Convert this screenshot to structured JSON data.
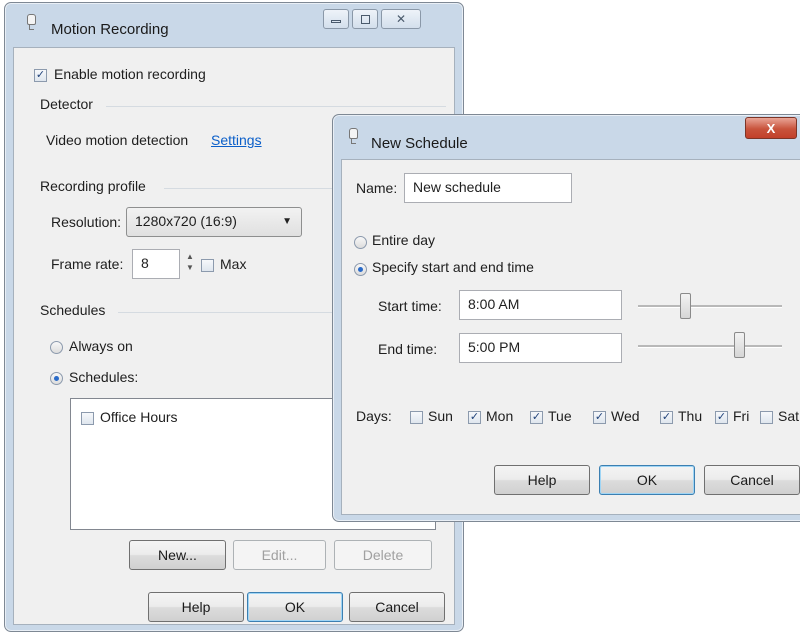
{
  "main_window": {
    "title": "Motion Recording",
    "enable_motion_recording": {
      "label": "Enable motion recording",
      "checked": true
    },
    "detector": {
      "heading": "Detector",
      "text": "Video motion detection",
      "settings_link": "Settings"
    },
    "recording_profile": {
      "heading": "Recording profile",
      "resolution_label": "Resolution:",
      "resolution_value": "1280x720 (16:9)",
      "frame_rate_label": "Frame rate:",
      "frame_rate_value": "8",
      "max_label": "Max",
      "max_checked": false
    },
    "schedules": {
      "heading": "Schedules",
      "always_on_label": "Always on",
      "schedules_label": "Schedules:",
      "selected": "schedules",
      "items": [
        {
          "label": "Office Hours",
          "checked": false
        }
      ],
      "new_button": "New...",
      "edit_button": "Edit...",
      "delete_button": "Delete"
    },
    "buttons": {
      "help": "Help",
      "ok": "OK",
      "cancel": "Cancel"
    }
  },
  "dialog": {
    "title": "New Schedule",
    "close_glyph": "X",
    "name_label": "Name:",
    "name_value": "New schedule",
    "entire_day_label": "Entire day",
    "specify_label": "Specify start and end time",
    "selected": "specify",
    "start_time_label": "Start time:",
    "start_time_value": "8:00 AM",
    "start_slider_fraction": 0.333,
    "end_time_label": "End time:",
    "end_time_value": "5:00 PM",
    "end_slider_fraction": 0.708,
    "days_label": "Days:",
    "days": [
      {
        "label": "Sun",
        "checked": false
      },
      {
        "label": "Mon",
        "checked": true
      },
      {
        "label": "Tue",
        "checked": true
      },
      {
        "label": "Wed",
        "checked": true
      },
      {
        "label": "Thu",
        "checked": true
      },
      {
        "label": "Fri",
        "checked": true
      },
      {
        "label": "Sat",
        "checked": false
      }
    ],
    "buttons": {
      "help": "Help",
      "ok": "OK",
      "cancel": "Cancel"
    }
  }
}
